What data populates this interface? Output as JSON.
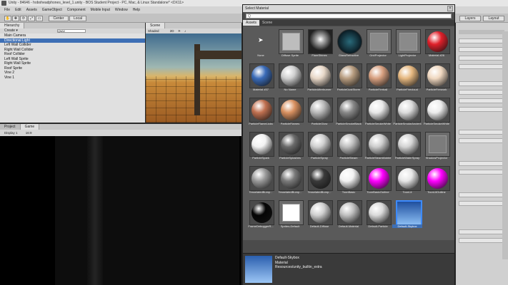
{
  "window": {
    "title": "Unity - 84646 - hoboheadphones_level_1.unity - BOS Student Project - PC, Mac, & Linux Standalone* <DX11>"
  },
  "menu": [
    "File",
    "Edit",
    "Assets",
    "GameObject",
    "Component",
    "Mobile Input",
    "Window",
    "Help"
  ],
  "toolbar": {
    "center": "Center",
    "local": "Local",
    "layers": "Layers",
    "layout": "Layout"
  },
  "hierarchy": {
    "tab": "Hierarchy",
    "create": "Create ▾",
    "search": "Q▾All",
    "items": [
      "Main Camera",
      "Directional Light",
      "Left Wall Collider",
      "Right Wall Collider",
      "Roof Collider",
      "Left Wall Sprite",
      "Right Wall Sprite",
      "Roof Sprite",
      "Vine 2",
      "Vine 1"
    ],
    "selected_index": 1
  },
  "scene": {
    "tab": "Scene",
    "mode": "Shaded",
    "dim": "2D"
  },
  "bottom": {
    "tab_project": "Project",
    "tab_game": "Game",
    "display": "Display 1",
    "aspect": "16:9"
  },
  "dialog": {
    "title": "Select Material",
    "close": "×",
    "search": "Q",
    "tabs": [
      "Assets",
      "Scene"
    ],
    "active_tab": 0,
    "items": [
      {
        "name": "None",
        "kind": "none"
      },
      {
        "name": "Diffuse Sprite",
        "kind": "flat",
        "color": "#bdbdbd"
      },
      {
        "name": "FlareShines",
        "kind": "flare"
      },
      {
        "name": "GlassRefractive",
        "kind": "glass"
      },
      {
        "name": "GridProjector",
        "kind": "flat",
        "color": "#8a8a8a"
      },
      {
        "name": "LightProjector",
        "kind": "flat",
        "color": "#8a8a8a"
      },
      {
        "name": "Material #26",
        "kind": "sphere",
        "color": "#e0202a"
      },
      {
        "name": "Material #37",
        "kind": "sphere",
        "color": "#3a6bb8"
      },
      {
        "name": "No Name",
        "kind": "sphere",
        "color": "#cfcfcf"
      },
      {
        "name": "ParticleAfterburner",
        "kind": "fire",
        "color": "#e8d8c8"
      },
      {
        "name": "ParticleDustStorm",
        "kind": "fire",
        "color": "#b89d80"
      },
      {
        "name": "ParticleFireball",
        "kind": "fire",
        "color": "#d8a080"
      },
      {
        "name": "ParticleFirecloud",
        "kind": "fire",
        "color": "#e6b880"
      },
      {
        "name": "ParticleFirework",
        "kind": "fire",
        "color": "#f0d8c0"
      },
      {
        "name": "ParticleFlameLicks",
        "kind": "fire",
        "color": "#c07050"
      },
      {
        "name": "ParticleFlames",
        "kind": "fire",
        "color": "#d89060"
      },
      {
        "name": "ParticleGlow",
        "kind": "sphere",
        "color": "#b8b8b8"
      },
      {
        "name": "ParticleSmokeBlack",
        "kind": "sphere",
        "color": "#888888"
      },
      {
        "name": "ParticleSmokeWhite",
        "kind": "sphere",
        "color": "#e8e8e8"
      },
      {
        "name": "ParticleSmokeAncient",
        "kind": "sphere",
        "color": "#dcdcdc"
      },
      {
        "name": "ParticleSmokeWhite",
        "kind": "sphere",
        "color": "#ececec"
      },
      {
        "name": "ParticleSpark",
        "kind": "sphere",
        "color": "#f2f2f2"
      },
      {
        "name": "ParticleSplashes",
        "kind": "sphere",
        "color": "#6a6a6a"
      },
      {
        "name": "ParticleSpray",
        "kind": "sphere",
        "color": "#d0d0d0"
      },
      {
        "name": "ParticleSteam",
        "kind": "sphere",
        "color": "#bfbfbf"
      },
      {
        "name": "ParticleSteamMobile",
        "kind": "sphere",
        "color": "#cdcdcd"
      },
      {
        "name": "ParticleWaterSpray",
        "kind": "sphere",
        "color": "#d4d4d4"
      },
      {
        "name": "ShadowProjector",
        "kind": "flat",
        "color": "#7c7c7c"
      },
      {
        "name": "TesselatedBump...",
        "kind": "rock",
        "color": "#9a9a9a"
      },
      {
        "name": "TesselatedBump...",
        "kind": "rock",
        "color": "#7a7a7a"
      },
      {
        "name": "TesselatedBump...",
        "kind": "sphere",
        "color": "#3a3a3a"
      },
      {
        "name": "ToonBasic",
        "kind": "sphere",
        "color": "#f2f2f2"
      },
      {
        "name": "ToonBasicOutline",
        "kind": "sphere",
        "color": "#ff00ff"
      },
      {
        "name": "ToonLit",
        "kind": "sphere",
        "color": "#e6e6e6"
      },
      {
        "name": "ToonLitOutline",
        "kind": "sphere",
        "color": "#ff00ff"
      },
      {
        "name": "FrameDebuggerR...",
        "kind": "sphere",
        "color": "#050505"
      },
      {
        "name": "Sprites-Default",
        "kind": "flat",
        "color": "#ffffff"
      },
      {
        "name": "Default-Diffuse",
        "kind": "sphere",
        "color": "#d0d0d0"
      },
      {
        "name": "Default-Material",
        "kind": "sphere",
        "color": "#c0c0c0"
      },
      {
        "name": "Default-Particle",
        "kind": "sphere",
        "color": "#dadada"
      },
      {
        "name": "Default-Skybox",
        "kind": "sky",
        "color": "#4a8ae0"
      }
    ],
    "selected_index": 40,
    "preview": {
      "name": "Default-Skybox",
      "type": "Material",
      "path": "Resources/unity_builtin_extra"
    }
  },
  "colors": {
    "selection": "#3d6fb5",
    "accent": "#3d8bff"
  }
}
